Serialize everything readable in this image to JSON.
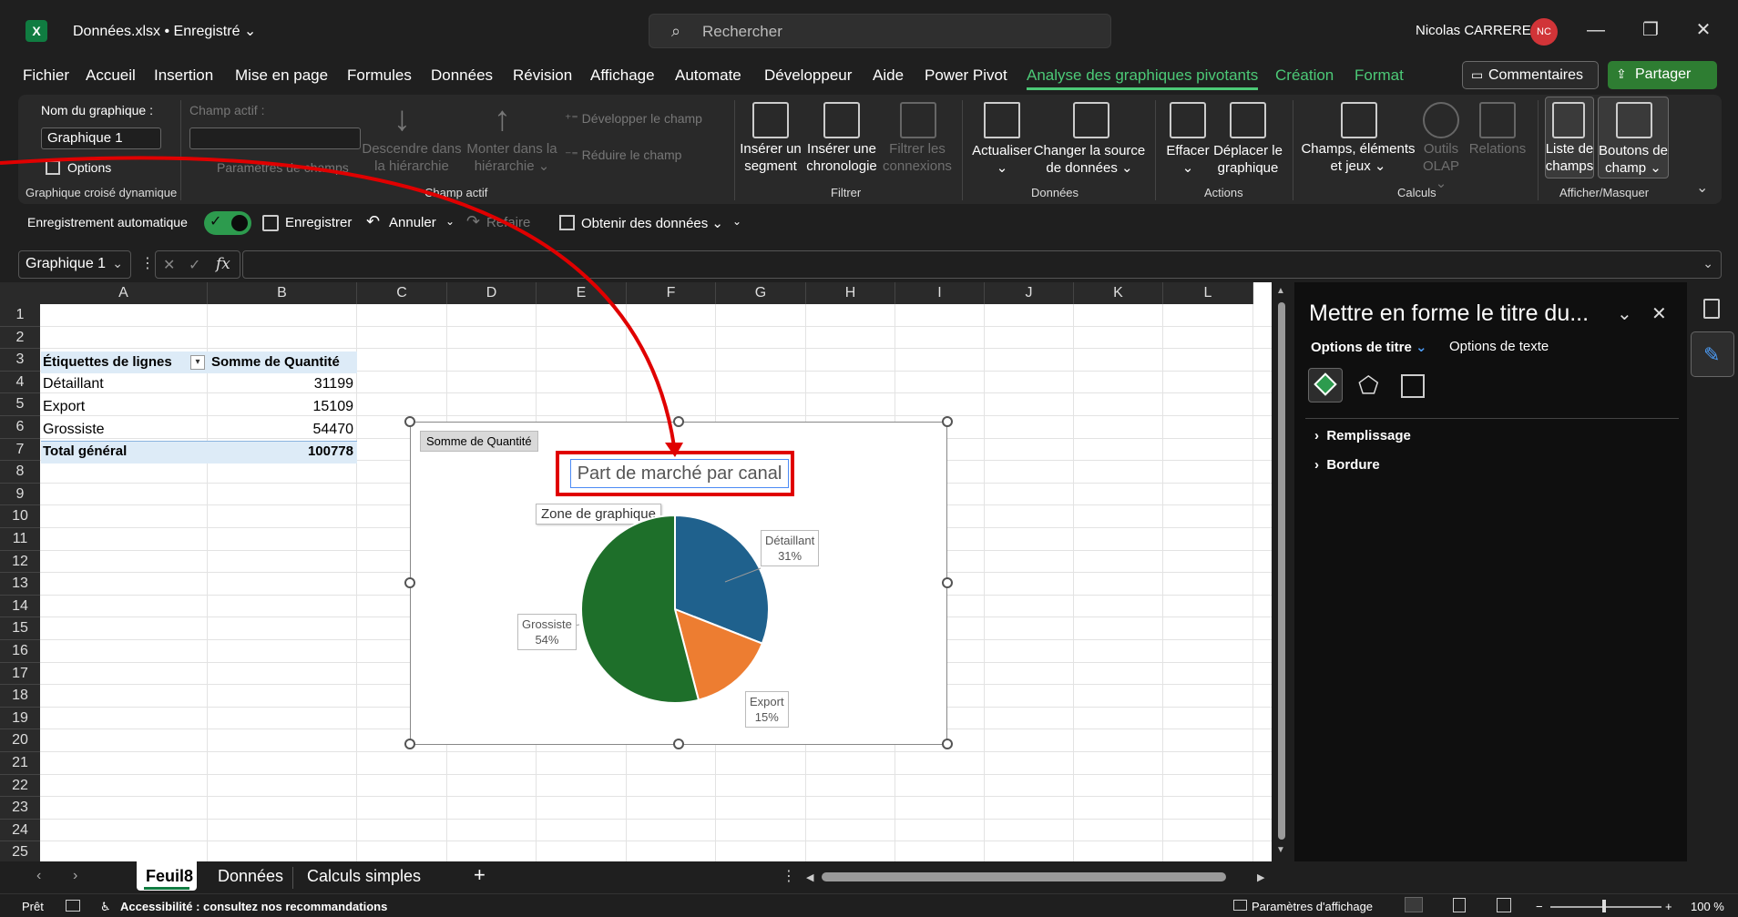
{
  "titlebar": {
    "logo": "X",
    "doc_title": "Données.xlsx • Enregistré ⌄",
    "search_placeholder": "Rechercher",
    "user_name": "Nicolas CARRERE",
    "user_initials": "NC"
  },
  "menu": {
    "tabs": [
      "Fichier",
      "Accueil",
      "Insertion",
      "Mise en page",
      "Formules",
      "Données",
      "Révision",
      "Affichage",
      "Automate",
      "Développeur",
      "Aide",
      "Power Pivot",
      "Analyse des graphiques pivotants",
      "Création",
      "Format"
    ],
    "comments_label": "Commentaires",
    "share_label": "Partager"
  },
  "ribbon": {
    "chart_name_label": "Nom du graphique :",
    "chart_name_value": "Graphique 1",
    "options_label": "Options",
    "group_pivotchart": "Graphique croisé dynamique",
    "active_field_label": "Champ actif :",
    "field_settings_label": "Paramètres de champs",
    "drill_down_label": "Descendre dans la hiérarchie",
    "drill_up_label": "Monter dans la hiérarchie ⌄",
    "expand_field_label": "Développer le champ",
    "collapse_field_label": "Réduire le champ",
    "group_active_field": "Champ actif",
    "insert_slicer_label": "Insérer un segment",
    "insert_timeline_label": "Insérer une chronologie",
    "filter_connections_label": "Filtrer les connexions",
    "group_filter": "Filtrer",
    "refresh_label": "Actualiser",
    "refresh_arrow": "⌄",
    "change_source_label": "Changer la source de données ⌄",
    "group_data": "Données",
    "clear_label": "Effacer",
    "clear_arrow": "⌄",
    "move_chart_label": "Déplacer le graphique",
    "group_actions": "Actions",
    "fields_items_label": "Champs, éléments et jeux ⌄",
    "olap_tools_label": "Outils OLAP ⌄",
    "relations_label": "Relations",
    "group_calculations": "Calculs",
    "field_list_label": "Liste de champs",
    "field_buttons_label": "Boutons de champ ⌄",
    "group_show_hide": "Afficher/Masquer"
  },
  "qat": {
    "autosave_label": "Enregistrement automatique",
    "save_label": "Enregistrer",
    "undo_label": "Annuler",
    "redo_label": "Refaire",
    "get_data_label": "Obtenir des données ⌄"
  },
  "formula_bar": {
    "name_box": "Graphique 1",
    "fx": "fx",
    "cancel": "✕",
    "confirm": "✓"
  },
  "grid": {
    "columns": [
      "A",
      "B",
      "C",
      "D",
      "E",
      "F",
      "G",
      "H",
      "I",
      "J",
      "K",
      "L"
    ],
    "rows": [
      "1",
      "2",
      "3",
      "4",
      "5",
      "6",
      "7",
      "8",
      "9",
      "10",
      "11",
      "12",
      "13",
      "14",
      "15",
      "16",
      "17",
      "18",
      "19",
      "20",
      "21",
      "22",
      "23",
      "24",
      "25"
    ],
    "pivot_header_a": "Étiquettes de lignes",
    "pivot_header_b": "Somme de Quantité",
    "pivot_rows": [
      {
        "label": "Détaillant",
        "value": "31199"
      },
      {
        "label": "Export",
        "value": "15109"
      },
      {
        "label": "Grossiste",
        "value": "54470"
      }
    ],
    "total_label": "Total général",
    "total_value": "100778"
  },
  "chart": {
    "field_button": "Somme de Quantité",
    "title": "Part de marché par canal",
    "tooltip": "Zone de graphique",
    "label_detaillant": "Détaillant",
    "pct_detaillant": "31%",
    "label_export": "Export",
    "pct_export": "15%",
    "label_grossiste": "Grossiste",
    "pct_grossiste": "54%",
    "colors": {
      "detaillant": "#1f618d",
      "export": "#ed7d31",
      "grossiste": "#1e6f2a"
    }
  },
  "chart_data": {
    "type": "pie",
    "title": "Part de marché par canal",
    "categories": [
      "Détaillant",
      "Export",
      "Grossiste"
    ],
    "values": [
      31199,
      15109,
      54470
    ],
    "percent_labels": [
      "31%",
      "15%",
      "54%"
    ],
    "colors": [
      "#1f618d",
      "#ed7d31",
      "#1e6f2a"
    ]
  },
  "pane": {
    "title": "Mettre en forme le titre du...",
    "tab_title_options": "Options de titre",
    "tab_text_options": "Options de texte",
    "section_fill": "Remplissage",
    "section_border": "Bordure"
  },
  "sheet_tabs": {
    "tabs": [
      "Feuil8",
      "Données",
      "Calculs simples"
    ],
    "add": "+"
  },
  "status": {
    "ready": "Prêt",
    "accessibility": "Accessibilité : consultez nos recommandations",
    "display_settings": "Paramètres d'affichage",
    "zoom": "100 %"
  }
}
